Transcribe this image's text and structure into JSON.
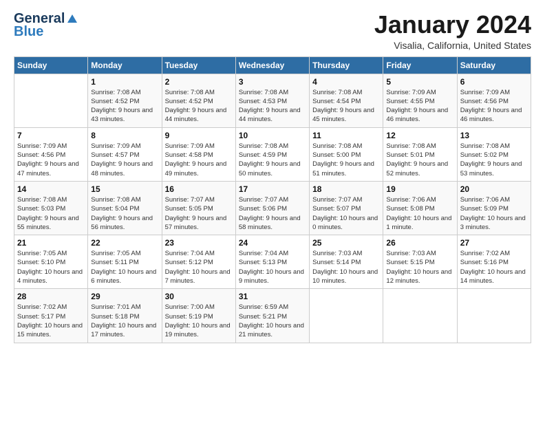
{
  "logo": {
    "line1": "General",
    "line2": "Blue"
  },
  "title": "January 2024",
  "subtitle": "Visalia, California, United States",
  "days_header": [
    "Sunday",
    "Monday",
    "Tuesday",
    "Wednesday",
    "Thursday",
    "Friday",
    "Saturday"
  ],
  "weeks": [
    [
      {
        "num": "",
        "sunrise": "",
        "sunset": "",
        "daylight": ""
      },
      {
        "num": "1",
        "sunrise": "Sunrise: 7:08 AM",
        "sunset": "Sunset: 4:52 PM",
        "daylight": "Daylight: 9 hours and 43 minutes."
      },
      {
        "num": "2",
        "sunrise": "Sunrise: 7:08 AM",
        "sunset": "Sunset: 4:52 PM",
        "daylight": "Daylight: 9 hours and 44 minutes."
      },
      {
        "num": "3",
        "sunrise": "Sunrise: 7:08 AM",
        "sunset": "Sunset: 4:53 PM",
        "daylight": "Daylight: 9 hours and 44 minutes."
      },
      {
        "num": "4",
        "sunrise": "Sunrise: 7:08 AM",
        "sunset": "Sunset: 4:54 PM",
        "daylight": "Daylight: 9 hours and 45 minutes."
      },
      {
        "num": "5",
        "sunrise": "Sunrise: 7:09 AM",
        "sunset": "Sunset: 4:55 PM",
        "daylight": "Daylight: 9 hours and 46 minutes."
      },
      {
        "num": "6",
        "sunrise": "Sunrise: 7:09 AM",
        "sunset": "Sunset: 4:56 PM",
        "daylight": "Daylight: 9 hours and 46 minutes."
      }
    ],
    [
      {
        "num": "7",
        "sunrise": "Sunrise: 7:09 AM",
        "sunset": "Sunset: 4:56 PM",
        "daylight": "Daylight: 9 hours and 47 minutes."
      },
      {
        "num": "8",
        "sunrise": "Sunrise: 7:09 AM",
        "sunset": "Sunset: 4:57 PM",
        "daylight": "Daylight: 9 hours and 48 minutes."
      },
      {
        "num": "9",
        "sunrise": "Sunrise: 7:09 AM",
        "sunset": "Sunset: 4:58 PM",
        "daylight": "Daylight: 9 hours and 49 minutes."
      },
      {
        "num": "10",
        "sunrise": "Sunrise: 7:08 AM",
        "sunset": "Sunset: 4:59 PM",
        "daylight": "Daylight: 9 hours and 50 minutes."
      },
      {
        "num": "11",
        "sunrise": "Sunrise: 7:08 AM",
        "sunset": "Sunset: 5:00 PM",
        "daylight": "Daylight: 9 hours and 51 minutes."
      },
      {
        "num": "12",
        "sunrise": "Sunrise: 7:08 AM",
        "sunset": "Sunset: 5:01 PM",
        "daylight": "Daylight: 9 hours and 52 minutes."
      },
      {
        "num": "13",
        "sunrise": "Sunrise: 7:08 AM",
        "sunset": "Sunset: 5:02 PM",
        "daylight": "Daylight: 9 hours and 53 minutes."
      }
    ],
    [
      {
        "num": "14",
        "sunrise": "Sunrise: 7:08 AM",
        "sunset": "Sunset: 5:03 PM",
        "daylight": "Daylight: 9 hours and 55 minutes."
      },
      {
        "num": "15",
        "sunrise": "Sunrise: 7:08 AM",
        "sunset": "Sunset: 5:04 PM",
        "daylight": "Daylight: 9 hours and 56 minutes."
      },
      {
        "num": "16",
        "sunrise": "Sunrise: 7:07 AM",
        "sunset": "Sunset: 5:05 PM",
        "daylight": "Daylight: 9 hours and 57 minutes."
      },
      {
        "num": "17",
        "sunrise": "Sunrise: 7:07 AM",
        "sunset": "Sunset: 5:06 PM",
        "daylight": "Daylight: 9 hours and 58 minutes."
      },
      {
        "num": "18",
        "sunrise": "Sunrise: 7:07 AM",
        "sunset": "Sunset: 5:07 PM",
        "daylight": "Daylight: 10 hours and 0 minutes."
      },
      {
        "num": "19",
        "sunrise": "Sunrise: 7:06 AM",
        "sunset": "Sunset: 5:08 PM",
        "daylight": "Daylight: 10 hours and 1 minute."
      },
      {
        "num": "20",
        "sunrise": "Sunrise: 7:06 AM",
        "sunset": "Sunset: 5:09 PM",
        "daylight": "Daylight: 10 hours and 3 minutes."
      }
    ],
    [
      {
        "num": "21",
        "sunrise": "Sunrise: 7:05 AM",
        "sunset": "Sunset: 5:10 PM",
        "daylight": "Daylight: 10 hours and 4 minutes."
      },
      {
        "num": "22",
        "sunrise": "Sunrise: 7:05 AM",
        "sunset": "Sunset: 5:11 PM",
        "daylight": "Daylight: 10 hours and 6 minutes."
      },
      {
        "num": "23",
        "sunrise": "Sunrise: 7:04 AM",
        "sunset": "Sunset: 5:12 PM",
        "daylight": "Daylight: 10 hours and 7 minutes."
      },
      {
        "num": "24",
        "sunrise": "Sunrise: 7:04 AM",
        "sunset": "Sunset: 5:13 PM",
        "daylight": "Daylight: 10 hours and 9 minutes."
      },
      {
        "num": "25",
        "sunrise": "Sunrise: 7:03 AM",
        "sunset": "Sunset: 5:14 PM",
        "daylight": "Daylight: 10 hours and 10 minutes."
      },
      {
        "num": "26",
        "sunrise": "Sunrise: 7:03 AM",
        "sunset": "Sunset: 5:15 PM",
        "daylight": "Daylight: 10 hours and 12 minutes."
      },
      {
        "num": "27",
        "sunrise": "Sunrise: 7:02 AM",
        "sunset": "Sunset: 5:16 PM",
        "daylight": "Daylight: 10 hours and 14 minutes."
      }
    ],
    [
      {
        "num": "28",
        "sunrise": "Sunrise: 7:02 AM",
        "sunset": "Sunset: 5:17 PM",
        "daylight": "Daylight: 10 hours and 15 minutes."
      },
      {
        "num": "29",
        "sunrise": "Sunrise: 7:01 AM",
        "sunset": "Sunset: 5:18 PM",
        "daylight": "Daylight: 10 hours and 17 minutes."
      },
      {
        "num": "30",
        "sunrise": "Sunrise: 7:00 AM",
        "sunset": "Sunset: 5:19 PM",
        "daylight": "Daylight: 10 hours and 19 minutes."
      },
      {
        "num": "31",
        "sunrise": "Sunrise: 6:59 AM",
        "sunset": "Sunset: 5:21 PM",
        "daylight": "Daylight: 10 hours and 21 minutes."
      },
      {
        "num": "",
        "sunrise": "",
        "sunset": "",
        "daylight": ""
      },
      {
        "num": "",
        "sunrise": "",
        "sunset": "",
        "daylight": ""
      },
      {
        "num": "",
        "sunrise": "",
        "sunset": "",
        "daylight": ""
      }
    ]
  ]
}
